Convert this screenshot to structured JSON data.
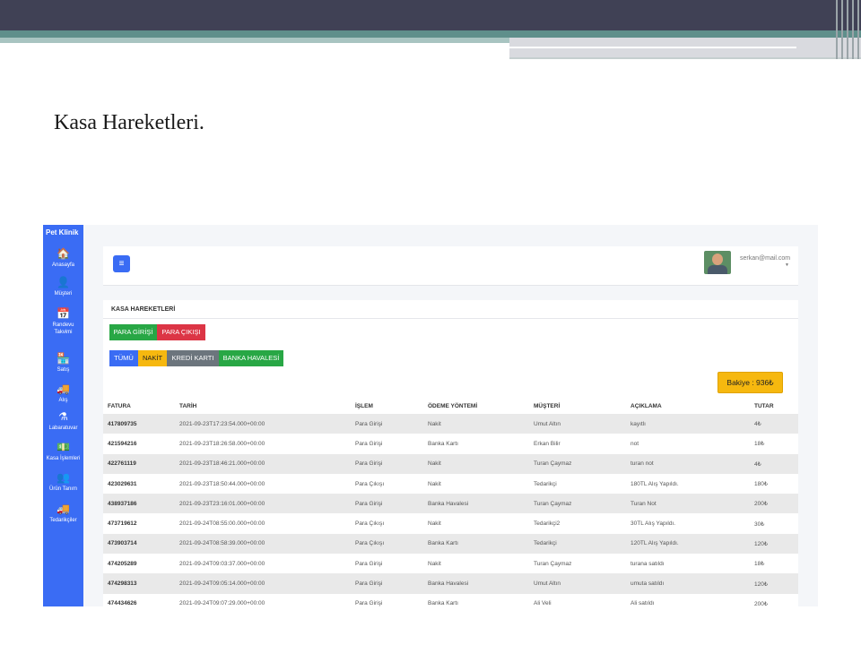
{
  "slide": {
    "title": "Kasa Hareketleri."
  },
  "sidebar": {
    "brand": "Pet Klinik",
    "items": [
      {
        "icon": "home-icon",
        "glyph": "🏠",
        "label": "Anasayfa"
      },
      {
        "icon": "user-icon",
        "glyph": "👤",
        "label": "Müşteri"
      },
      {
        "icon": "calendar-icon",
        "glyph": "📅",
        "label": "Randevu Takvimi"
      },
      {
        "icon": "shop-icon",
        "glyph": "🏪",
        "label": "Satış"
      },
      {
        "icon": "truck-icon",
        "glyph": "🚚",
        "label": "Alış"
      },
      {
        "icon": "flask-icon",
        "glyph": "⚗",
        "label": "Labaratuvar"
      },
      {
        "icon": "cash-icon",
        "glyph": "💵",
        "label": "Kasa İşlemleri"
      },
      {
        "icon": "people-icon",
        "glyph": "👥",
        "label": "Ürün Tanım"
      },
      {
        "icon": "truck-icon",
        "glyph": "🚚",
        "label": "Tedarikçiler"
      }
    ]
  },
  "header": {
    "menu_glyph": "≡",
    "user_email": "serkan@mail.com",
    "caret": "▼"
  },
  "card": {
    "title": "KASA HAREKETLERİ",
    "actions": [
      {
        "label": "PARA GİRİŞİ",
        "color": "#28a745"
      },
      {
        "label": "PARA ÇIKIŞI",
        "color": "#dc3545"
      }
    ],
    "filters": [
      {
        "label": "TÜMÜ",
        "color": "#3a6cf4"
      },
      {
        "label": "NAKİT",
        "color": "#f6b80f"
      },
      {
        "label": "KREDİ KARTI",
        "color": "#6c757d"
      },
      {
        "label": "BANKA HAVALESİ",
        "color": "#28a745"
      }
    ],
    "balance": "Bakiye : 936₺"
  },
  "table": {
    "columns": [
      "FATURA",
      "TARİH",
      "İŞLEM",
      "ÖDEME YÖNTEMİ",
      "MÜŞTERİ",
      "AÇIKLAMA",
      "TUTAR"
    ],
    "rows": [
      [
        "417809735",
        "2021-09-23T17:23:54.000+00:00",
        "Para Girişi",
        "Nakit",
        "Umut Altın",
        "kayıtlı",
        "4₺"
      ],
      [
        "421594216",
        "2021-09-23T18:26:58.000+00:00",
        "Para Girişi",
        "Banka Kartı",
        "Erkan Bilir",
        "not",
        "18₺"
      ],
      [
        "422761119",
        "2021-09-23T18:46:21.000+00:00",
        "Para Girişi",
        "Nakit",
        "Turan Çaymaz",
        "turan not",
        "4₺"
      ],
      [
        "423029631",
        "2021-09-23T18:50:44.000+00:00",
        "Para Çıkışı",
        "Nakit",
        "Tedarikçi",
        "180TL Alış Yapıldı.",
        "180₺"
      ],
      [
        "438937186",
        "2021-09-23T23:16:01.000+00:00",
        "Para Girişi",
        "Banka Havalesi",
        "Turan Çaymaz",
        "Turan Not",
        "200₺"
      ],
      [
        "473719612",
        "2021-09-24T08:55:00.000+00:00",
        "Para Çıkışı",
        "Nakit",
        "Tedarikçi2",
        "30TL Alış Yapıldı.",
        "30₺"
      ],
      [
        "473903714",
        "2021-09-24T08:58:39.000+00:00",
        "Para Çıkışı",
        "Banka Kartı",
        "Tedarikçi",
        "120TL Alış Yapıldı.",
        "120₺"
      ],
      [
        "474205289",
        "2021-09-24T09:03:37.000+00:00",
        "Para Girişi",
        "Nakit",
        "Turan Çaymaz",
        "turana satıldı",
        "18₺"
      ],
      [
        "474298313",
        "2021-09-24T09:05:14.000+00:00",
        "Para Girişi",
        "Banka Havalesi",
        "Umut Altın",
        "umuta satıldı",
        "120₺"
      ],
      [
        "474434626",
        "2021-09-24T09:07:29.000+00:00",
        "Para Girişi",
        "Banka Kartı",
        "Ali Veli",
        "Ali satıldı",
        "200₺"
      ]
    ]
  }
}
